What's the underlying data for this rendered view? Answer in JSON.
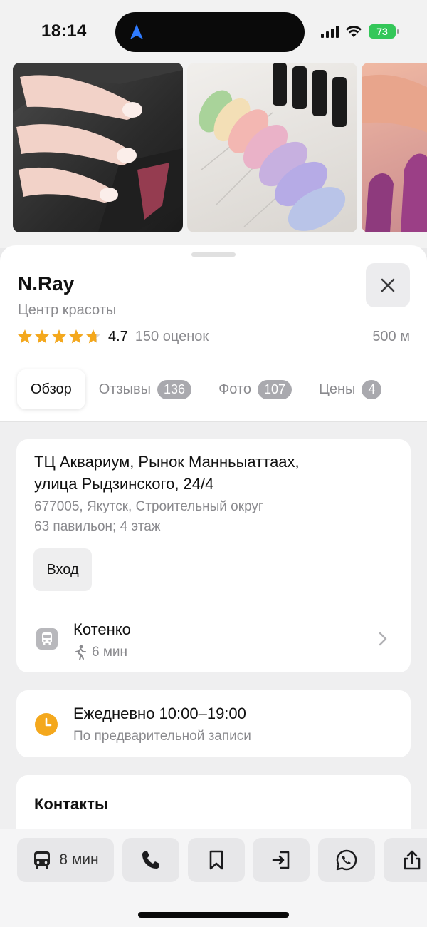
{
  "status_bar": {
    "time": "18:14",
    "battery": "73"
  },
  "icons": {
    "nav_arrow": "location-arrow-icon",
    "signal": "cellular-signal-icon",
    "wifi": "wifi-icon",
    "battery": "battery-icon",
    "close": "close-icon",
    "star": "star-icon",
    "bus_stop": "bus-stop-icon",
    "walk": "walking-person-icon",
    "chevron": "chevron-right-icon",
    "clock": "clock-icon",
    "bus": "bus-icon",
    "phone": "phone-icon",
    "bookmark": "bookmark-icon",
    "enter": "enter-icon",
    "whatsapp": "whatsapp-icon",
    "share": "share-icon"
  },
  "place": {
    "name": "N.Ray",
    "category": "Центр красоты",
    "rating": "4.7",
    "rating_fill": 4.7,
    "rating_count": "150 оценок",
    "distance": "500 м"
  },
  "tabs": [
    {
      "label": "Обзор",
      "count": ""
    },
    {
      "label": "Отзывы",
      "count": "136"
    },
    {
      "label": "Фото",
      "count": "107"
    },
    {
      "label": "Цены",
      "count": "4"
    }
  ],
  "address": {
    "line1": "ТЦ Аквариум, Рынок Манньыаттаах,",
    "line2": "улица Рыдзинского, 24/4",
    "line3": "677005, Якутск, Строительный округ",
    "line4": "63 павильон; 4 этаж",
    "entrance_label": "Вход"
  },
  "transit": {
    "stop_name": "Котенко",
    "walk_time": "6 мин"
  },
  "hours": {
    "schedule": "Ежедневно 10:00–19:00",
    "note": "По предварительной записи"
  },
  "contacts": {
    "title": "Контакты"
  },
  "actions": {
    "route_label": "8 мин"
  },
  "colors": {
    "star": "#f4a81d",
    "clock": "#f4a81d",
    "battery": "#34c759",
    "nav_arrow": "#2f7bff"
  }
}
